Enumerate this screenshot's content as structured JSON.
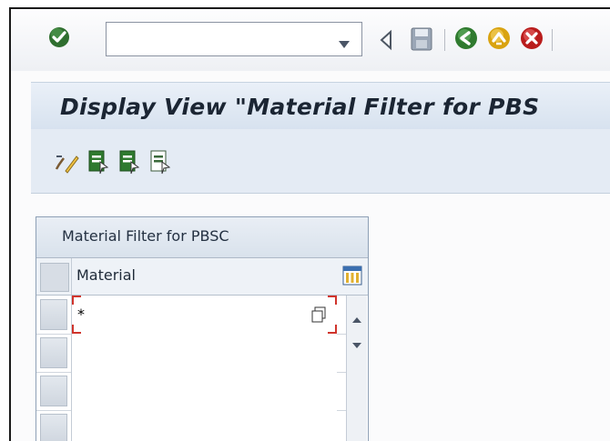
{
  "toolbar": {
    "command_field": {
      "value": "",
      "placeholder": ""
    },
    "icons": [
      "enter-icon",
      "back-icon",
      "save-icon",
      "back-green-icon",
      "exit-icon",
      "cancel-icon"
    ]
  },
  "title": "Display View \"Material Filter for PBS",
  "app_toolbar": {
    "icons": [
      "display-change-icon",
      "select-all-icon",
      "select-block-icon",
      "deselect-all-icon"
    ]
  },
  "table": {
    "title": "Material Filter for PBSC",
    "columns": [
      "Material"
    ],
    "rows": [
      {
        "material": "*"
      },
      {
        "material": ""
      },
      {
        "material": ""
      },
      {
        "material": ""
      }
    ]
  },
  "colors": {
    "title_bar": "#dbe5f0",
    "table_border": "#8ea0b6",
    "focus_bracket": "#d0342c",
    "enter_green": "#2e7d32"
  }
}
